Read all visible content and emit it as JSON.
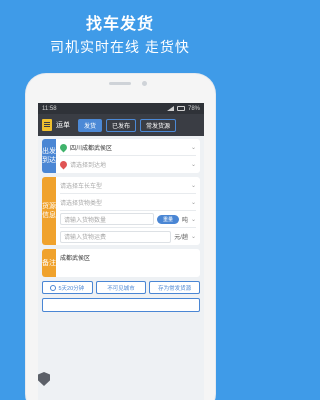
{
  "promo": {
    "title": "找车发货",
    "subtitle": "司机实时在线 走货快"
  },
  "status_bar": {
    "time": "11:58",
    "battery": "78%"
  },
  "topbar": {
    "title": "运单",
    "tabs": [
      {
        "label": "发货",
        "active": true
      },
      {
        "label": "已发布",
        "active": false
      },
      {
        "label": "常发货源",
        "active": false
      }
    ]
  },
  "departure": {
    "label": "出发到达",
    "origin": "四川成都武侯区",
    "destination_placeholder": "请选择到达地"
  },
  "cargo": {
    "label": "货源信息",
    "vehicle_placeholder": "请选择车长车型",
    "cargo_type_placeholder": "请选择货物类型",
    "quantity_placeholder": "请输入货物数量",
    "quantity_toggle": "重量",
    "quantity_unit": "吨",
    "freight_placeholder": "请输入货物运费",
    "freight_unit": "元/趟"
  },
  "notes": {
    "label": "备注",
    "value": "成都武侯区"
  },
  "footer": {
    "time_button": "5天20分钟",
    "exclude_button": "不可见城市",
    "save_button": "存为常发货源"
  },
  "colors": {
    "background": "#3f9be8",
    "accent_blue": "#4a86d4",
    "accent_orange": "#f0a22c",
    "topbar": "#3a3d44"
  }
}
